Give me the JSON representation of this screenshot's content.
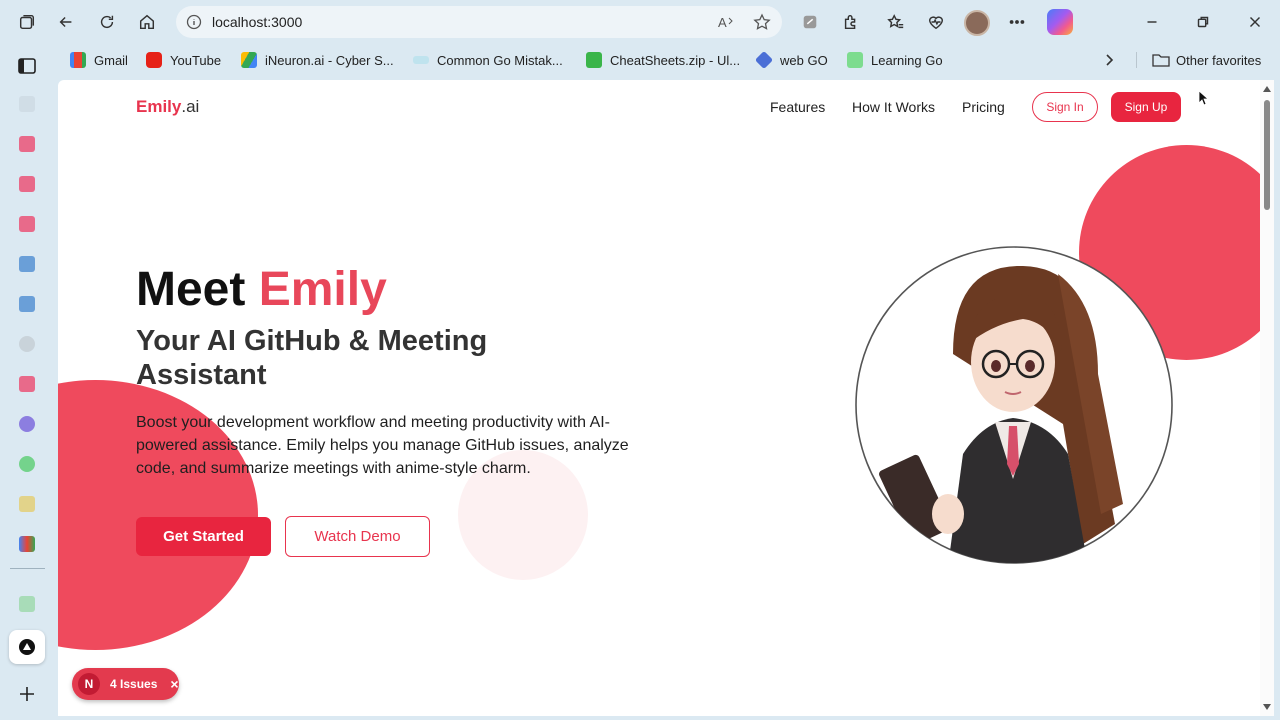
{
  "browser": {
    "url": "localhost:3000",
    "bookmarks": [
      {
        "label": "Gmail"
      },
      {
        "label": "YouTube"
      },
      {
        "label": "iNeuron.ai - Cyber S..."
      },
      {
        "label": "Common Go Mistak..."
      },
      {
        "label": "CheatSheets.zip - Ul..."
      },
      {
        "label": "web GO"
      },
      {
        "label": "Learning Go"
      }
    ],
    "other_favorites": "Other favorites"
  },
  "nav": {
    "logo_main": "Emily",
    "logo_suffix": ".ai",
    "links": [
      "Features",
      "How It Works",
      "Pricing"
    ],
    "sign_in": "Sign In",
    "sign_up": "Sign Up"
  },
  "hero": {
    "title_prefix": "Meet ",
    "title_accent": "Emily",
    "subtitle": "Your AI GitHub & Meeting Assistant",
    "description": "Boost your development workflow and meeting productivity with AI-powered assistance. Emily helps you manage GitHub issues, analyze code, and summarize meetings with anime-style charm.",
    "primary_button": "Get Started",
    "secondary_button": "Watch Demo"
  },
  "devtools": {
    "badge_letter": "N",
    "issues_label": "4 Issues"
  },
  "colors": {
    "accent": "#e8344e",
    "accent_circle": "#ef4a5d"
  }
}
